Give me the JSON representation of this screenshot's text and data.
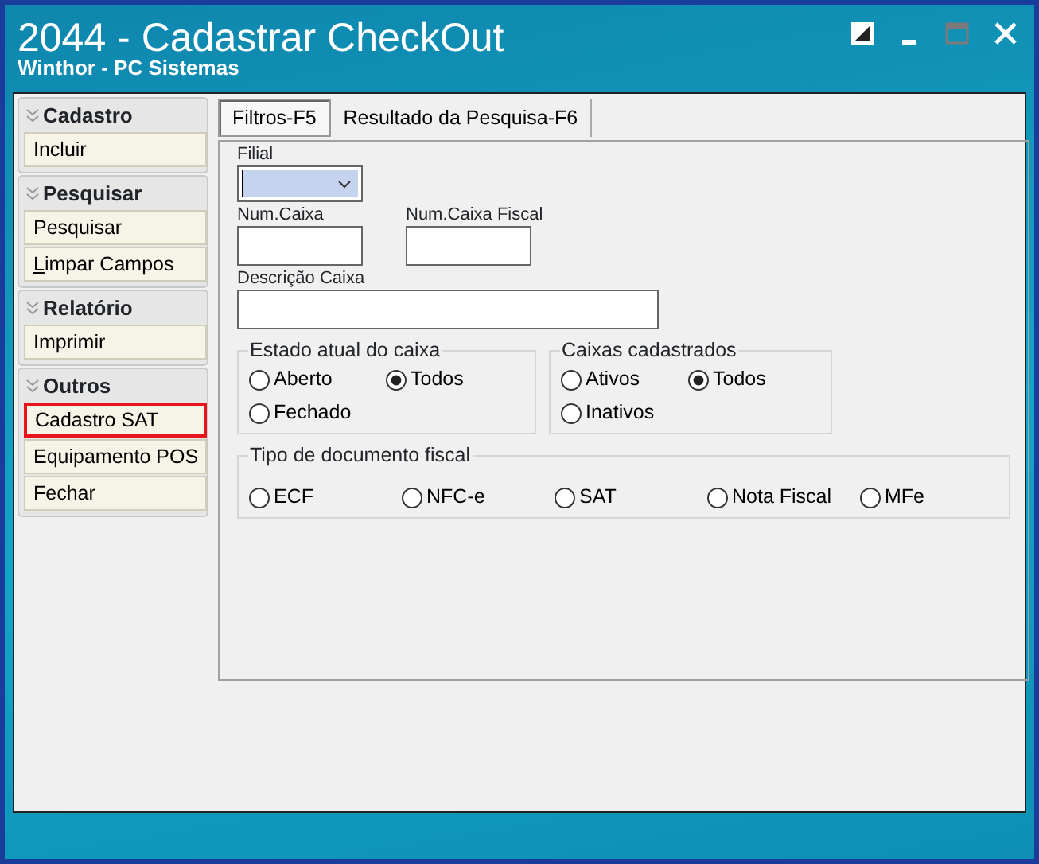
{
  "window": {
    "title": "2044 - Cadastrar CheckOut",
    "subtitle": "Winthor - PC Sistemas"
  },
  "sidebar": {
    "groups": [
      {
        "title": "Cadastro",
        "items": [
          {
            "label": "Incluir",
            "highlighted": false,
            "mnemonic": false
          }
        ]
      },
      {
        "title": "Pesquisar",
        "items": [
          {
            "label": "Pesquisar",
            "highlighted": false,
            "mnemonic": false
          },
          {
            "label": "Limpar Campos",
            "highlighted": false,
            "mnemonic": true
          }
        ]
      },
      {
        "title": "Relatório",
        "items": [
          {
            "label": "Imprimir",
            "highlighted": false,
            "mnemonic": false
          }
        ]
      },
      {
        "title": "Outros",
        "items": [
          {
            "label": "Cadastro SAT",
            "highlighted": true,
            "mnemonic": false
          },
          {
            "label": "Equipamento POS",
            "highlighted": false,
            "mnemonic": false
          },
          {
            "label": "Fechar",
            "highlighted": false,
            "mnemonic": false
          }
        ]
      }
    ]
  },
  "tabs": [
    {
      "label": "Filtros-F5",
      "selected": true
    },
    {
      "label": "Resultado da Pesquisa-F6",
      "selected": false
    }
  ],
  "fields": [
    {
      "label": "Filial",
      "kind": "dropdown"
    },
    {
      "label": "Num.Caixa",
      "kind": "short"
    },
    {
      "label": "Num.Caixa Fiscal",
      "kind": "short"
    },
    {
      "label": "Descrição Caixa",
      "kind": "wide"
    }
  ],
  "radio_groups": [
    {
      "title": "Estado atual do caixa",
      "options": [
        {
          "label": "Aberto",
          "selected": false
        },
        {
          "label": "Todos",
          "selected": true
        },
        {
          "label": "Fechado",
          "selected": false
        }
      ]
    },
    {
      "title": "Caixas cadastrados",
      "options": [
        {
          "label": "Ativos",
          "selected": false
        },
        {
          "label": "Todos",
          "selected": true
        },
        {
          "label": "Inativos",
          "selected": false
        }
      ]
    },
    {
      "title": "Tipo de documento fiscal",
      "options": [
        {
          "label": "ECF",
          "selected": false
        },
        {
          "label": "NFC-e",
          "selected": false
        },
        {
          "label": "SAT",
          "selected": false
        },
        {
          "label": "Nota Fiscal",
          "selected": false
        },
        {
          "label": "MFe",
          "selected": false
        }
      ]
    }
  ]
}
